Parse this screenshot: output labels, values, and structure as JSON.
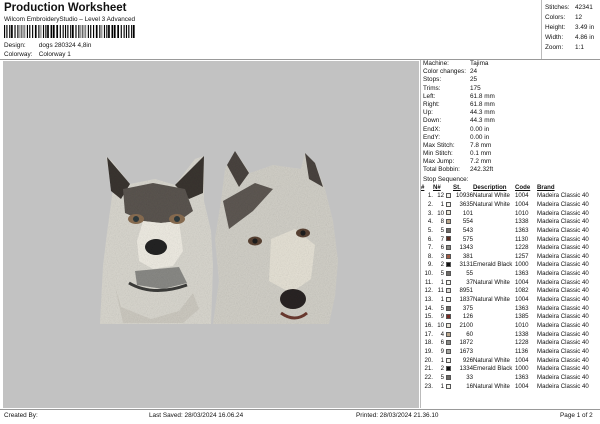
{
  "header": {
    "title": "Production Worksheet",
    "subtitle": "Wilcom EmbroideryStudio – Level 3 Advanced",
    "design_label": "Design:",
    "design_value": "dogs 280324 4,8in",
    "colorway_label": "Colorway:",
    "colorway_value": "Colorway 1"
  },
  "top_stats": [
    {
      "label": "Stitches:",
      "value": "42341"
    },
    {
      "label": "Colors:",
      "value": "12"
    },
    {
      "label": "Height:",
      "value": "3.49 in"
    },
    {
      "label": "Width:",
      "value": "4.86 in"
    },
    {
      "label": "Zoom:",
      "value": "1:1"
    }
  ],
  "machine_info": [
    {
      "label": "Machine:",
      "value": "Tajima"
    },
    {
      "label": "Color changes:",
      "value": "24"
    },
    {
      "label": "Stops:",
      "value": "25"
    },
    {
      "label": "Trims:",
      "value": "175"
    },
    {
      "label": "Left:",
      "value": "61.8 mm"
    },
    {
      "label": "Right:",
      "value": "61.8 mm"
    },
    {
      "label": "Up:",
      "value": "44.3 mm"
    },
    {
      "label": "Down:",
      "value": "44.3 mm"
    },
    {
      "label": "EndX:",
      "value": "0.00 in"
    },
    {
      "label": "EndY:",
      "value": "0.00 in"
    },
    {
      "label": "Max Stitch:",
      "value": "7.8 mm"
    },
    {
      "label": "Min Stitch:",
      "value": "0.1 mm"
    },
    {
      "label": "Max Jump:",
      "value": "7.2 mm"
    },
    {
      "label": "Total Bobbin:",
      "value": "242.32ft"
    }
  ],
  "stop_sequence_label": "Stop Sequence:",
  "sequence_headers": [
    "#",
    "N#",
    "",
    "St.",
    "Description",
    "Code",
    "Brand"
  ],
  "sequence": [
    {
      "n": "1.",
      "nn": "12",
      "color": "#f3f2ec",
      "st": "10936",
      "desc": "Natural White",
      "code": "1004",
      "brand": "Madeira Classic 40"
    },
    {
      "n": "2.",
      "nn": "1",
      "color": "#f3f2ec",
      "st": "3635",
      "desc": "Natural White",
      "code": "1004",
      "brand": "Madeira Classic 40"
    },
    {
      "n": "3.",
      "nn": "10",
      "color": "#e9e4d6",
      "st": "101",
      "desc": "",
      "code": "1010",
      "brand": "Madeira Classic 40"
    },
    {
      "n": "4.",
      "nn": "8",
      "color": "#b9a68c",
      "st": "554",
      "desc": "",
      "code": "1338",
      "brand": "Madeira Classic 40"
    },
    {
      "n": "5.",
      "nn": "5",
      "color": "#6d6a66",
      "st": "543",
      "desc": "",
      "code": "1363",
      "brand": "Madeira Classic 40"
    },
    {
      "n": "6.",
      "nn": "7",
      "color": "#5a2e22",
      "st": "575",
      "desc": "",
      "code": "1130",
      "brand": "Madeira Classic 40"
    },
    {
      "n": "7.",
      "nn": "6",
      "color": "#8a8a86",
      "st": "1343",
      "desc": "",
      "code": "1228",
      "brand": "Madeira Classic 40"
    },
    {
      "n": "8.",
      "nn": "3",
      "color": "#9e5a44",
      "st": "381",
      "desc": "",
      "code": "1257",
      "brand": "Madeira Classic 40"
    },
    {
      "n": "9.",
      "nn": "2",
      "color": "#111111",
      "st": "3131",
      "desc": "Emerald Black",
      "code": "1000",
      "brand": "Madeira Classic 40"
    },
    {
      "n": "10.",
      "nn": "5",
      "color": "#6d6a66",
      "st": "55",
      "desc": "",
      "code": "1363",
      "brand": "Madeira Classic 40"
    },
    {
      "n": "11.",
      "nn": "1",
      "color": "#f3f2ec",
      "st": "37",
      "desc": "Natural White",
      "code": "1004",
      "brand": "Madeira Classic 40"
    },
    {
      "n": "12.",
      "nn": "11",
      "color": "#dad8d2",
      "st": "8951",
      "desc": "",
      "code": "1082",
      "brand": "Madeira Classic 40"
    },
    {
      "n": "13.",
      "nn": "1",
      "color": "#f3f2ec",
      "st": "1837",
      "desc": "Natural White",
      "code": "1004",
      "brand": "Madeira Classic 40"
    },
    {
      "n": "14.",
      "nn": "5",
      "color": "#6d6a66",
      "st": "375",
      "desc": "",
      "code": "1363",
      "brand": "Madeira Classic 40"
    },
    {
      "n": "15.",
      "nn": "9",
      "color": "#7a2c24",
      "st": "126",
      "desc": "",
      "code": "1385",
      "brand": "Madeira Classic 40"
    },
    {
      "n": "16.",
      "nn": "10",
      "color": "#e9e4d6",
      "st": "2100",
      "desc": "",
      "code": "1010",
      "brand": "Madeira Classic 40"
    },
    {
      "n": "17.",
      "nn": "4",
      "color": "#b9a68c",
      "st": "60",
      "desc": "",
      "code": "1338",
      "brand": "Madeira Classic 40"
    },
    {
      "n": "18.",
      "nn": "6",
      "color": "#8a8a86",
      "st": "1872",
      "desc": "",
      "code": "1228",
      "brand": "Madeira Classic 40"
    },
    {
      "n": "19.",
      "nn": "9",
      "color": "#a3a39e",
      "st": "1673",
      "desc": "",
      "code": "1136",
      "brand": "Madeira Classic 40"
    },
    {
      "n": "20.",
      "nn": "1",
      "color": "#f3f2ec",
      "st": "926",
      "desc": "Natural White",
      "code": "1004",
      "brand": "Madeira Classic 40"
    },
    {
      "n": "21.",
      "nn": "2",
      "color": "#111111",
      "st": "1334",
      "desc": "Emerald Black",
      "code": "1000",
      "brand": "Madeira Classic 40"
    },
    {
      "n": "22.",
      "nn": "5",
      "color": "#6d6a66",
      "st": "33",
      "desc": "",
      "code": "1363",
      "brand": "Madeira Classic 40"
    },
    {
      "n": "23.",
      "nn": "1",
      "color": "#f3f2ec",
      "st": "16",
      "desc": "Natural White",
      "code": "1004",
      "brand": "Madeira Classic 40"
    }
  ],
  "footer": {
    "created_by": "Created By:",
    "last_saved": "Last Saved: 28/03/2024 16.06.24",
    "printed": "Printed: 28/03/2024 21.36.10",
    "page": "Page 1 of 2"
  }
}
